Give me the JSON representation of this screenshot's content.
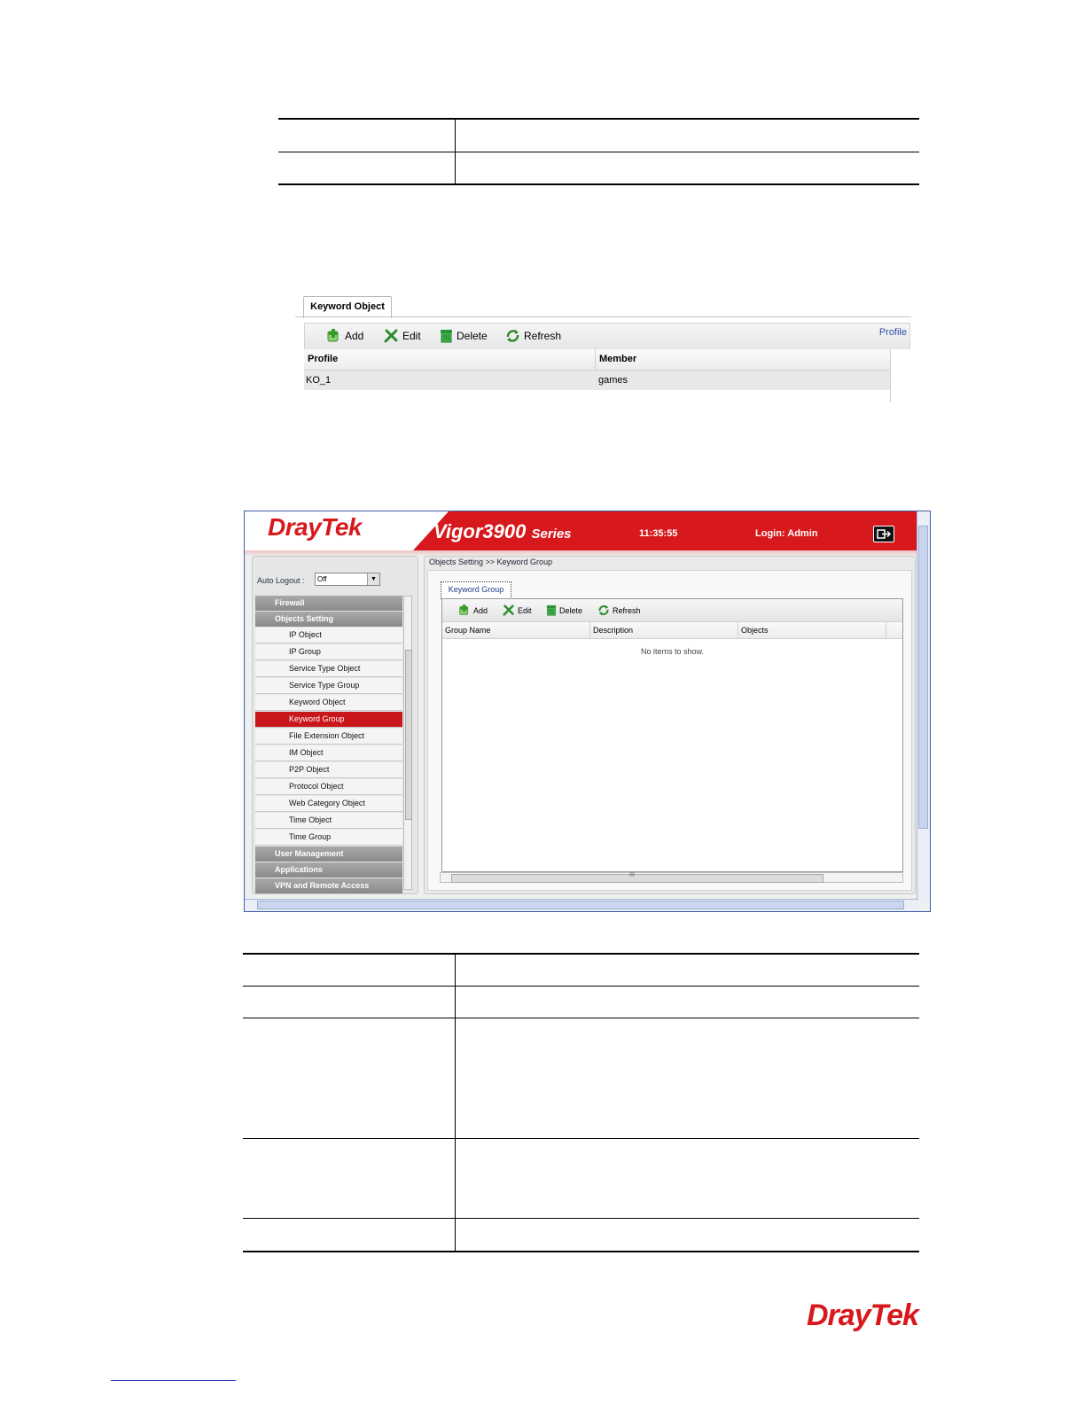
{
  "keyword_object_figure": {
    "tab_label": "Keyword Object",
    "toolbar": {
      "add": "Add",
      "edit": "Edit",
      "delete": "Delete",
      "refresh": "Refresh",
      "profile_link": "Profile"
    },
    "columns": [
      "Profile",
      "Member"
    ],
    "rows": [
      {
        "profile": "KO_1",
        "member": "games"
      }
    ]
  },
  "vigor_screenshot": {
    "brand": "DrayTek",
    "model": "Vigor3900",
    "series": "Series",
    "time": "11:35:55",
    "login": "Login: Admin",
    "auto_logout_label": "Auto Logout :",
    "auto_logout_value": "Off",
    "breadcrumb": "Objects Setting >> Keyword Group",
    "menu": [
      {
        "label": "Firewall",
        "type": "category"
      },
      {
        "label": "Objects Setting",
        "type": "category"
      },
      {
        "label": "IP Object",
        "type": "sub"
      },
      {
        "label": "IP Group",
        "type": "sub"
      },
      {
        "label": "Service Type Object",
        "type": "sub"
      },
      {
        "label": "Service Type Group",
        "type": "sub"
      },
      {
        "label": "Keyword Object",
        "type": "sub"
      },
      {
        "label": "Keyword Group",
        "type": "sub",
        "active": true
      },
      {
        "label": "File Extension Object",
        "type": "sub"
      },
      {
        "label": "IM Object",
        "type": "sub"
      },
      {
        "label": "P2P Object",
        "type": "sub"
      },
      {
        "label": "Protocol Object",
        "type": "sub"
      },
      {
        "label": "Web Category Object",
        "type": "sub"
      },
      {
        "label": "Time Object",
        "type": "sub"
      },
      {
        "label": "Time Group",
        "type": "sub"
      },
      {
        "label": "User Management",
        "type": "category"
      },
      {
        "label": "Applications",
        "type": "category"
      },
      {
        "label": "VPN and Remote Access",
        "type": "category"
      }
    ],
    "tab_label": "Keyword Group",
    "toolbar": {
      "add": "Add",
      "edit": "Edit",
      "delete": "Delete",
      "refresh": "Refresh"
    },
    "columns": [
      "Group Name",
      "Description",
      "Objects"
    ],
    "empty_message": "No items to show.",
    "scroll_marker": "III"
  },
  "footer": {
    "brand": "DrayTek"
  },
  "colors": {
    "brand_red": "#d7181c",
    "active_menu": "#c9161a",
    "link_blue": "#2b4fa8"
  }
}
